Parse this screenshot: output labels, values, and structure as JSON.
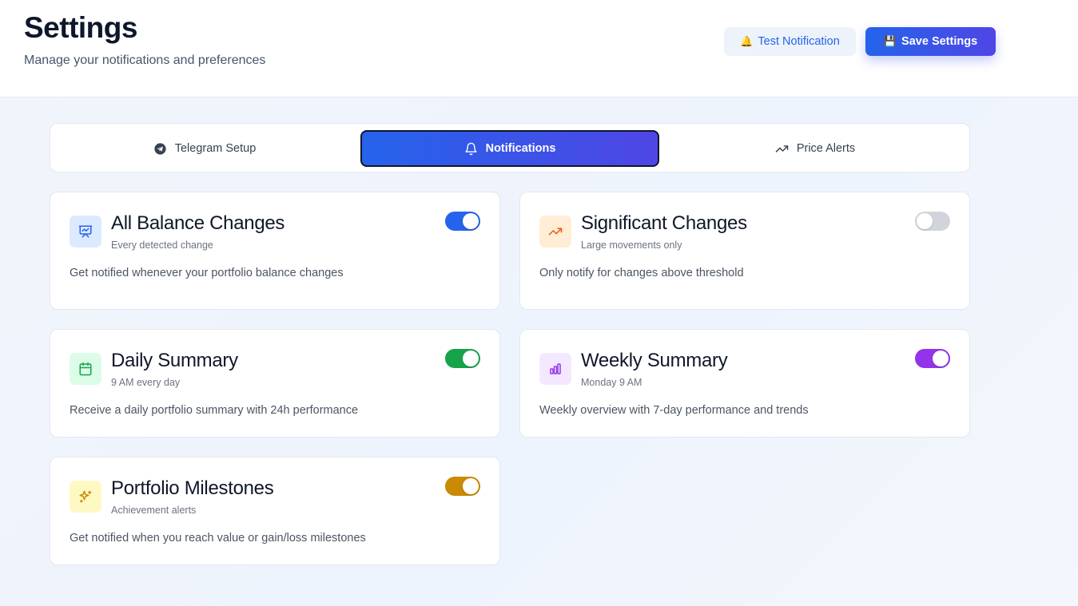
{
  "header": {
    "title": "Settings",
    "subtitle": "Manage your notifications and preferences",
    "test_button": {
      "emoji": "🔔",
      "label": "Test Notification"
    },
    "save_button": {
      "emoji": "💾",
      "label": "Save Settings"
    }
  },
  "tabs": [
    {
      "label": "Telegram Setup",
      "icon": "telegram-icon",
      "active": false
    },
    {
      "label": "Notifications",
      "icon": "bell-icon",
      "active": true
    },
    {
      "label": "Price Alerts",
      "icon": "trending-up-icon",
      "active": false
    }
  ],
  "cards": [
    {
      "title": "All Balance Changes",
      "subtitle": "Every detected change",
      "description": "Get notified whenever your portfolio balance changes",
      "icon": "presentation-chart-icon",
      "enabled": true,
      "accent": "#2563eb",
      "icon_bg": "#dbeafe"
    },
    {
      "title": "Significant Changes",
      "subtitle": "Large movements only",
      "description": "Only notify for changes above threshold",
      "icon": "trending-up-icon",
      "enabled": false,
      "accent": "#ea580c",
      "icon_bg": "#ffedd5"
    },
    {
      "title": "Daily Summary",
      "subtitle": "9 AM every day",
      "description": "Receive a daily portfolio summary with 24h performance",
      "icon": "calendar-icon",
      "enabled": true,
      "accent": "#16a34a",
      "icon_bg": "#dcfce7"
    },
    {
      "title": "Weekly Summary",
      "subtitle": "Monday 9 AM",
      "description": "Weekly overview with 7-day performance and trends",
      "icon": "bar-chart-icon",
      "enabled": true,
      "accent": "#9333ea",
      "icon_bg": "#f3e8ff"
    },
    {
      "title": "Portfolio Milestones",
      "subtitle": "Achievement alerts",
      "description": "Get notified when you reach value or gain/loss milestones",
      "icon": "sparkles-icon",
      "enabled": true,
      "accent": "#ca8a04",
      "icon_bg": "#fef9c3"
    }
  ],
  "colors": {
    "primary": "#2563eb",
    "primary_gradient_end": "#4f46e5",
    "toggle_off": "#d1d5db"
  }
}
